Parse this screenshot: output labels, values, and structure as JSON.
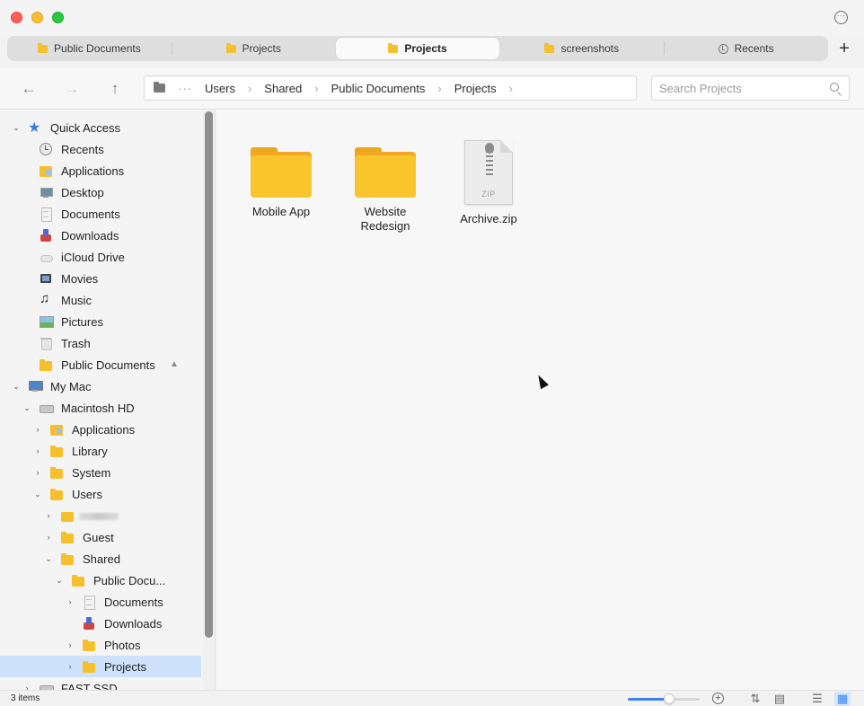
{
  "tabs": [
    {
      "label": "Public Documents",
      "icon": "folder-icon",
      "active": false
    },
    {
      "label": "Projects",
      "icon": "folder-icon",
      "active": false
    },
    {
      "label": "Projects",
      "icon": "folder-icon",
      "active": true
    },
    {
      "label": "screenshots",
      "icon": "folder-icon",
      "active": false
    },
    {
      "label": "Recents",
      "icon": "clock-icon",
      "active": false
    }
  ],
  "toolbar": {
    "back": "←",
    "forward": "→",
    "up": "↑",
    "path_ellipsis": "···",
    "path": [
      "Users",
      "Shared",
      "Public Documents",
      "Projects"
    ],
    "search_placeholder": "Search Projects"
  },
  "sidebar": {
    "quick_access": {
      "label": "Quick Access",
      "items": [
        {
          "label": "Recents",
          "icon": "clock-icon"
        },
        {
          "label": "Applications",
          "icon": "applications-icon"
        },
        {
          "label": "Desktop",
          "icon": "desktop-icon"
        },
        {
          "label": "Documents",
          "icon": "document-icon"
        },
        {
          "label": "Downloads",
          "icon": "downloads-icon"
        },
        {
          "label": "iCloud Drive",
          "icon": "cloud-icon"
        },
        {
          "label": "Movies",
          "icon": "movie-icon"
        },
        {
          "label": "Music",
          "icon": "music-icon"
        },
        {
          "label": "Pictures",
          "icon": "pictures-icon"
        },
        {
          "label": "Trash",
          "icon": "trash-icon"
        },
        {
          "label": "Public Documents",
          "icon": "folder-icon",
          "pinned": true
        }
      ]
    },
    "my_mac": {
      "label": "My Mac",
      "macintosh_hd": "Macintosh HD",
      "tree": [
        {
          "label": "Applications"
        },
        {
          "label": "Library"
        },
        {
          "label": "System"
        },
        {
          "label": "Users"
        },
        {
          "label": ""
        },
        {
          "label": "Guest"
        },
        {
          "label": "Shared"
        },
        {
          "label": "Public Docu..."
        },
        {
          "label": "Documents"
        },
        {
          "label": "Downloads"
        },
        {
          "label": "Photos"
        },
        {
          "label": "Projects"
        },
        {
          "label": "FAST SSD"
        }
      ]
    }
  },
  "content": {
    "items": [
      {
        "name": "Mobile App",
        "type": "folder"
      },
      {
        "name": "Website\nRedesign",
        "type": "folder"
      },
      {
        "name": "Archive.zip",
        "type": "zip",
        "badge": "ZIP"
      }
    ]
  },
  "status": {
    "item_count": "3 items",
    "zoom_level": 0.58
  },
  "colors": {
    "accent": "#3b82f0",
    "folder": "#f9c52c",
    "selection": "#cfe2fc"
  }
}
